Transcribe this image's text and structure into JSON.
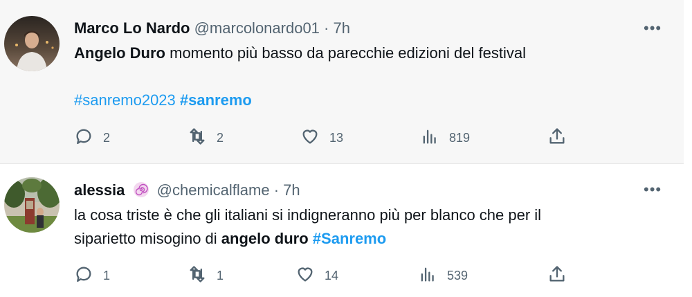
{
  "tweets": [
    {
      "name": "Marco Lo Nardo",
      "handle": "@marcolonardo01",
      "sep": "·",
      "time": "7h",
      "more": "•••",
      "text": {
        "bold": "Angelo Duro",
        "rest": " momento più basso da parecchie edizioni del festival",
        "tag1": "#sanremo2023",
        "tag2": "#sanremo"
      },
      "counts": {
        "replies": "2",
        "retweets": "2",
        "likes": "13",
        "views": "819"
      }
    },
    {
      "name": "alessia",
      "badge_icon": "spiral-badge-icon",
      "handle": "@chemicalflame",
      "sep": "·",
      "time": "7h",
      "more": "•••",
      "text": {
        "line1": "la cosa triste è che gli italiani si indigneranno più per blanco che per il",
        "line2a": "siparietto misogino di ",
        "bold": "angelo duro",
        "tag": "#Sanremo"
      },
      "counts": {
        "replies": "1",
        "retweets": "1",
        "likes": "14",
        "views": "539"
      }
    }
  ],
  "colors": {
    "accent": "#1d9bf0",
    "meta": "#536471",
    "highlight_bg": "#f7f7f7"
  }
}
